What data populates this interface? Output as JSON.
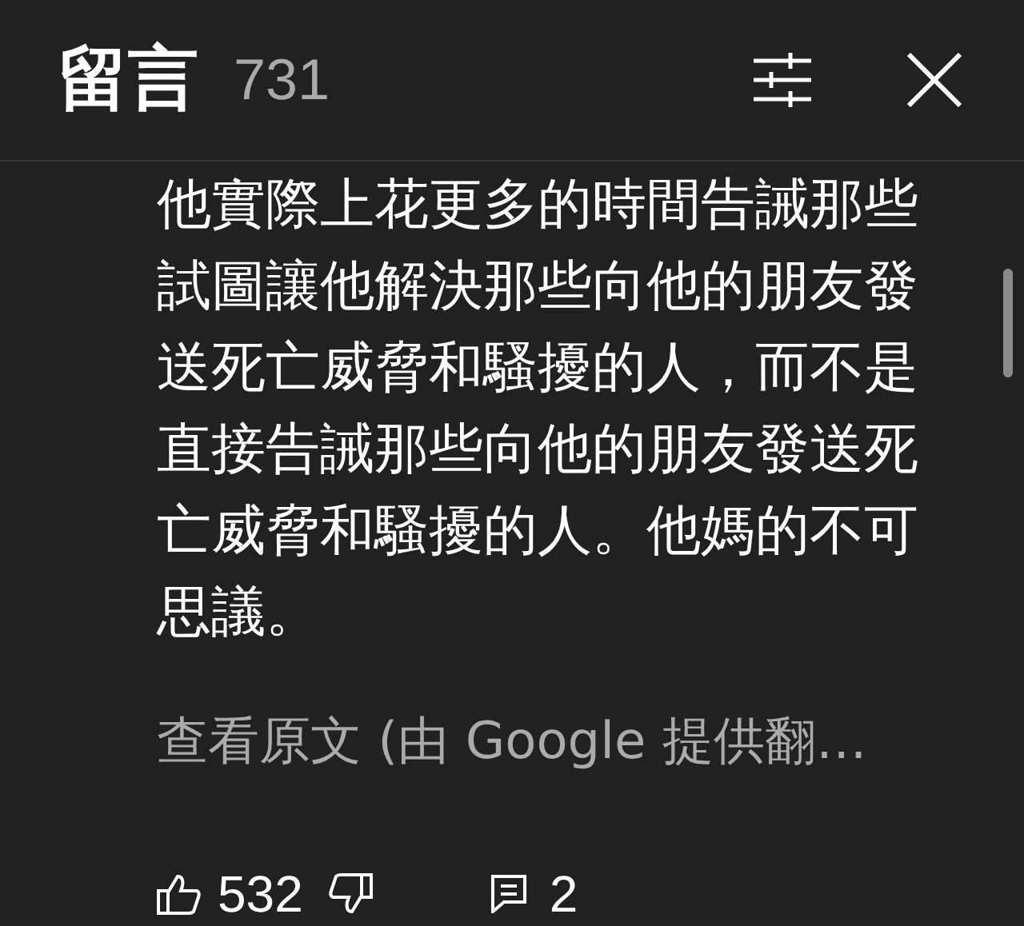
{
  "header": {
    "title": "留言",
    "count": "731"
  },
  "comment": {
    "text": "他實際上花更多的時間告誡那些試圖讓他解決那些向他的朋友發送死亡威脅和騷擾的人，而不是直接告誡那些向他的朋友發送死亡威脅和騷擾的人。他媽的不可思議。",
    "translation_link": "查看原文 (由 Google 提供翻…",
    "likes": "532",
    "replies": "2"
  }
}
